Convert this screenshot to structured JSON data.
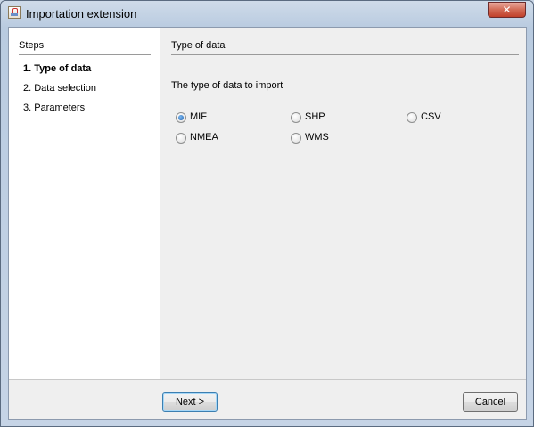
{
  "window": {
    "title": "Importation extension",
    "close_glyph": "✕"
  },
  "steps": {
    "title": "Steps",
    "items": [
      {
        "label": "1.  Type of data",
        "active": true
      },
      {
        "label": "2.  Data selection",
        "active": false
      },
      {
        "label": "3.  Parameters",
        "active": false
      }
    ]
  },
  "main": {
    "section_title": "Type of data",
    "prompt": "The type of data to import",
    "options": [
      {
        "label": "MIF",
        "checked": true
      },
      {
        "label": "SHP",
        "checked": false
      },
      {
        "label": "CSV",
        "checked": false
      },
      {
        "label": "NMEA",
        "checked": false
      },
      {
        "label": "WMS",
        "checked": false
      }
    ]
  },
  "buttons": {
    "next": "Next >",
    "cancel": "Cancel"
  },
  "icons": {
    "app": "java-coffee-icon",
    "close": "close-icon"
  }
}
